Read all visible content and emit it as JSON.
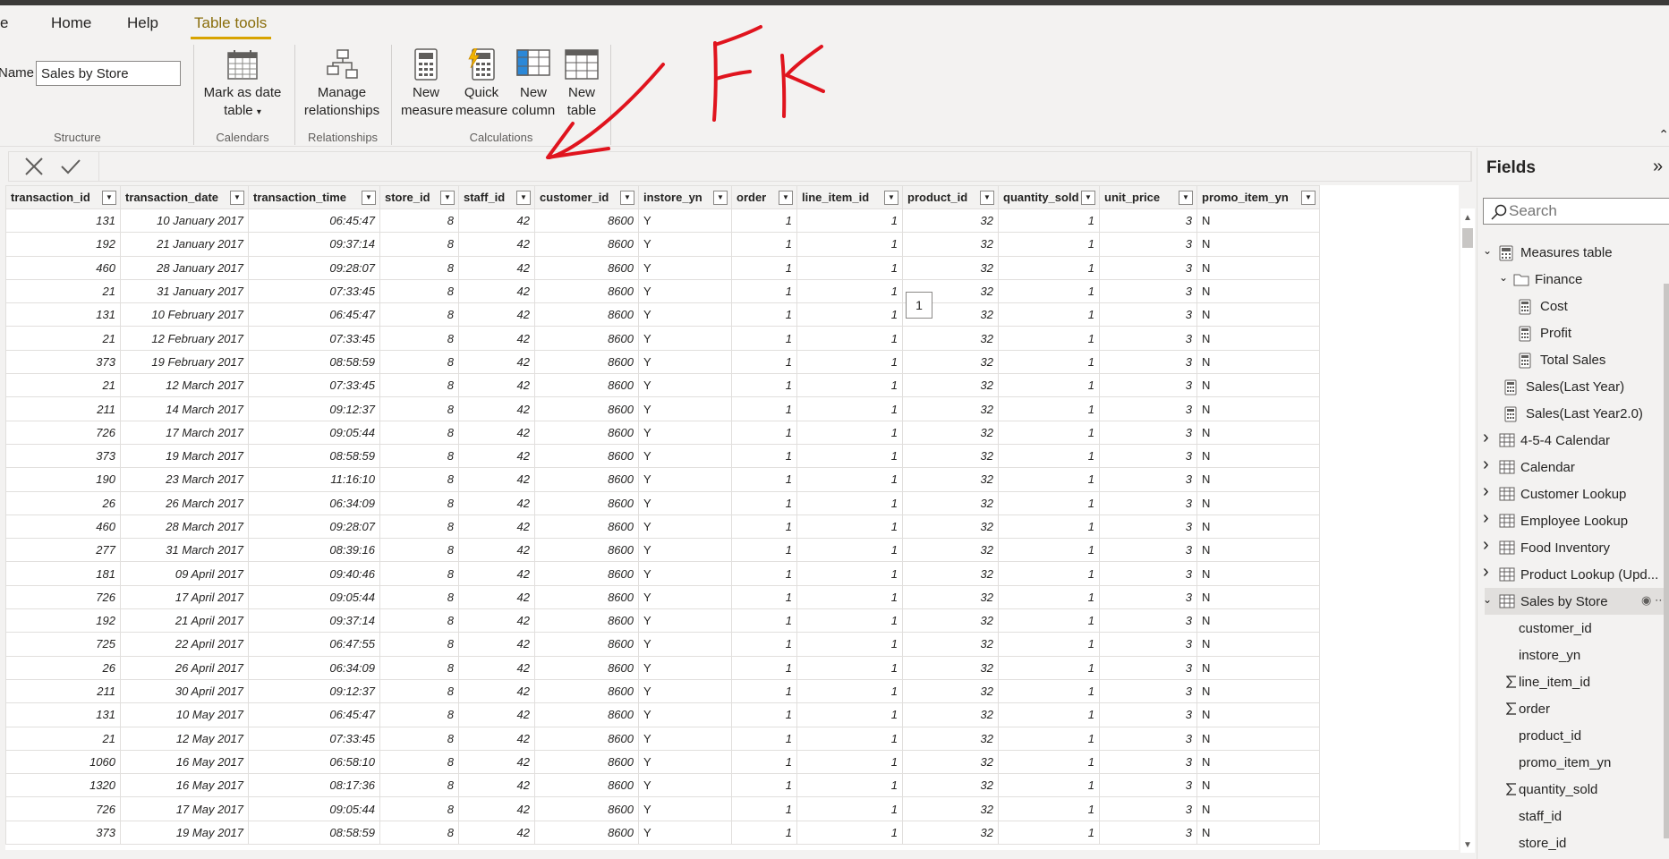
{
  "ribbon_tabs": [
    {
      "label": "e"
    },
    {
      "label": "Home"
    },
    {
      "label": "Help"
    },
    {
      "label": "Table tools"
    }
  ],
  "structure": {
    "name_label": "Name",
    "name_value": "Sales by Store",
    "group_label": "Structure"
  },
  "calendars": {
    "mark_as_date_label_1": "Mark as date",
    "mark_as_date_label_2": "table",
    "group_label": "Calendars"
  },
  "relationships": {
    "manage_label_1": "Manage",
    "manage_label_2": "relationships",
    "group_label": "Relationships"
  },
  "calculations": {
    "new_measure_1": "New",
    "new_measure_2": "measure",
    "quick_measure_1": "Quick",
    "quick_measure_2": "measure",
    "new_column_1": "New",
    "new_column_2": "column",
    "new_table_1": "New",
    "new_table_2": "table",
    "group_label": "Calculations"
  },
  "annotation_text": "FK",
  "tooltip_value": "1",
  "grid": {
    "columns": [
      "transaction_id",
      "transaction_date",
      "transaction_time",
      "store_id",
      "staff_id",
      "customer_id",
      "instore_yn",
      "order",
      "line_item_id",
      "product_id",
      "quantity_sold",
      "unit_price",
      "promo_item_yn"
    ],
    "rows": [
      [
        "131",
        "10 January 2017",
        "06:45:47",
        "8",
        "42",
        "8600",
        "Y",
        "1",
        "1",
        "32",
        "1",
        "3",
        "N"
      ],
      [
        "192",
        "21 January 2017",
        "09:37:14",
        "8",
        "42",
        "8600",
        "Y",
        "1",
        "1",
        "32",
        "1",
        "3",
        "N"
      ],
      [
        "460",
        "28 January 2017",
        "09:28:07",
        "8",
        "42",
        "8600",
        "Y",
        "1",
        "1",
        "32",
        "1",
        "3",
        "N"
      ],
      [
        "21",
        "31 January 2017",
        "07:33:45",
        "8",
        "42",
        "8600",
        "Y",
        "1",
        "1",
        "32",
        "1",
        "3",
        "N"
      ],
      [
        "131",
        "10 February 2017",
        "06:45:47",
        "8",
        "42",
        "8600",
        "Y",
        "1",
        "1",
        "32",
        "1",
        "3",
        "N"
      ],
      [
        "21",
        "12 February 2017",
        "07:33:45",
        "8",
        "42",
        "8600",
        "Y",
        "1",
        "1",
        "32",
        "1",
        "3",
        "N"
      ],
      [
        "373",
        "19 February 2017",
        "08:58:59",
        "8",
        "42",
        "8600",
        "Y",
        "1",
        "1",
        "32",
        "1",
        "3",
        "N"
      ],
      [
        "21",
        "12 March 2017",
        "07:33:45",
        "8",
        "42",
        "8600",
        "Y",
        "1",
        "1",
        "32",
        "1",
        "3",
        "N"
      ],
      [
        "211",
        "14 March 2017",
        "09:12:37",
        "8",
        "42",
        "8600",
        "Y",
        "1",
        "1",
        "32",
        "1",
        "3",
        "N"
      ],
      [
        "726",
        "17 March 2017",
        "09:05:44",
        "8",
        "42",
        "8600",
        "Y",
        "1",
        "1",
        "32",
        "1",
        "3",
        "N"
      ],
      [
        "373",
        "19 March 2017",
        "08:58:59",
        "8",
        "42",
        "8600",
        "Y",
        "1",
        "1",
        "32",
        "1",
        "3",
        "N"
      ],
      [
        "190",
        "23 March 2017",
        "11:16:10",
        "8",
        "42",
        "8600",
        "Y",
        "1",
        "1",
        "32",
        "1",
        "3",
        "N"
      ],
      [
        "26",
        "26 March 2017",
        "06:34:09",
        "8",
        "42",
        "8600",
        "Y",
        "1",
        "1",
        "32",
        "1",
        "3",
        "N"
      ],
      [
        "460",
        "28 March 2017",
        "09:28:07",
        "8",
        "42",
        "8600",
        "Y",
        "1",
        "1",
        "32",
        "1",
        "3",
        "N"
      ],
      [
        "277",
        "31 March 2017",
        "08:39:16",
        "8",
        "42",
        "8600",
        "Y",
        "1",
        "1",
        "32",
        "1",
        "3",
        "N"
      ],
      [
        "181",
        "09 April 2017",
        "09:40:46",
        "8",
        "42",
        "8600",
        "Y",
        "1",
        "1",
        "32",
        "1",
        "3",
        "N"
      ],
      [
        "726",
        "17 April 2017",
        "09:05:44",
        "8",
        "42",
        "8600",
        "Y",
        "1",
        "1",
        "32",
        "1",
        "3",
        "N"
      ],
      [
        "192",
        "21 April 2017",
        "09:37:14",
        "8",
        "42",
        "8600",
        "Y",
        "1",
        "1",
        "32",
        "1",
        "3",
        "N"
      ],
      [
        "725",
        "22 April 2017",
        "06:47:55",
        "8",
        "42",
        "8600",
        "Y",
        "1",
        "1",
        "32",
        "1",
        "3",
        "N"
      ],
      [
        "26",
        "26 April 2017",
        "06:34:09",
        "8",
        "42",
        "8600",
        "Y",
        "1",
        "1",
        "32",
        "1",
        "3",
        "N"
      ],
      [
        "211",
        "30 April 2017",
        "09:12:37",
        "8",
        "42",
        "8600",
        "Y",
        "1",
        "1",
        "32",
        "1",
        "3",
        "N"
      ],
      [
        "131",
        "10 May 2017",
        "06:45:47",
        "8",
        "42",
        "8600",
        "Y",
        "1",
        "1",
        "32",
        "1",
        "3",
        "N"
      ],
      [
        "21",
        "12 May 2017",
        "07:33:45",
        "8",
        "42",
        "8600",
        "Y",
        "1",
        "1",
        "32",
        "1",
        "3",
        "N"
      ],
      [
        "1060",
        "16 May 2017",
        "06:58:10",
        "8",
        "42",
        "8600",
        "Y",
        "1",
        "1",
        "32",
        "1",
        "3",
        "N"
      ],
      [
        "1320",
        "16 May 2017",
        "08:17:36",
        "8",
        "42",
        "8600",
        "Y",
        "1",
        "1",
        "32",
        "1",
        "3",
        "N"
      ],
      [
        "726",
        "17 May 2017",
        "09:05:44",
        "8",
        "42",
        "8600",
        "Y",
        "1",
        "1",
        "32",
        "1",
        "3",
        "N"
      ],
      [
        "373",
        "19 May 2017",
        "08:58:59",
        "8",
        "42",
        "8600",
        "Y",
        "1",
        "1",
        "32",
        "1",
        "3",
        "N"
      ]
    ]
  },
  "fields": {
    "title": "Fields",
    "search_placeholder": "Search",
    "tree": [
      {
        "label": "Measures table",
        "icon": "calculator-table-icon",
        "level": 0,
        "arrow": "expanded"
      },
      {
        "label": "Finance",
        "icon": "folder-icon",
        "level": 1,
        "arrow": "expanded"
      },
      {
        "label": "Cost",
        "icon": "calculator-icon",
        "level": 2,
        "arrow": ""
      },
      {
        "label": "Profit",
        "icon": "calculator-icon",
        "level": 2,
        "arrow": ""
      },
      {
        "label": "Total Sales",
        "icon": "calculator-icon",
        "level": 2,
        "arrow": ""
      },
      {
        "label": "Sales(Last Year)",
        "icon": "calculator-icon",
        "level": 1.5,
        "arrow": ""
      },
      {
        "label": "Sales(Last Year2.0)",
        "icon": "calculator-icon",
        "level": 1.5,
        "arrow": ""
      },
      {
        "label": "4-5-4 Calendar",
        "icon": "table-icon",
        "level": 0,
        "arrow": "collapsed"
      },
      {
        "label": "Calendar",
        "icon": "table-icon",
        "level": 0,
        "arrow": "collapsed"
      },
      {
        "label": "Customer Lookup",
        "icon": "table-icon",
        "level": 0,
        "arrow": "collapsed"
      },
      {
        "label": "Employee Lookup",
        "icon": "table-icon",
        "level": 0,
        "arrow": "collapsed"
      },
      {
        "label": "Food Inventory",
        "icon": "table-icon",
        "level": 0,
        "arrow": "collapsed"
      },
      {
        "label": "Product Lookup (Upd...",
        "icon": "table-icon",
        "level": 0,
        "arrow": "collapsed"
      },
      {
        "label": "Sales by Store",
        "icon": "table-icon",
        "level": 0,
        "arrow": "expanded",
        "selected": true
      },
      {
        "label": "customer_id",
        "icon": "",
        "level": 2
      },
      {
        "label": "instore_yn",
        "icon": "",
        "level": 2
      },
      {
        "label": "line_item_id",
        "icon": "sigma-icon",
        "level": 2
      },
      {
        "label": "order",
        "icon": "sigma-icon",
        "level": 2
      },
      {
        "label": "product_id",
        "icon": "",
        "level": 2
      },
      {
        "label": "promo_item_yn",
        "icon": "",
        "level": 2
      },
      {
        "label": "quantity_sold",
        "icon": "sigma-icon",
        "level": 2
      },
      {
        "label": "staff_id",
        "icon": "",
        "level": 2
      },
      {
        "label": "store_id",
        "icon": "",
        "level": 2
      }
    ]
  },
  "colors": {
    "accent_tab": "#d8a300",
    "annotation_red": "#e0141e",
    "background": "#f3f2f1"
  }
}
